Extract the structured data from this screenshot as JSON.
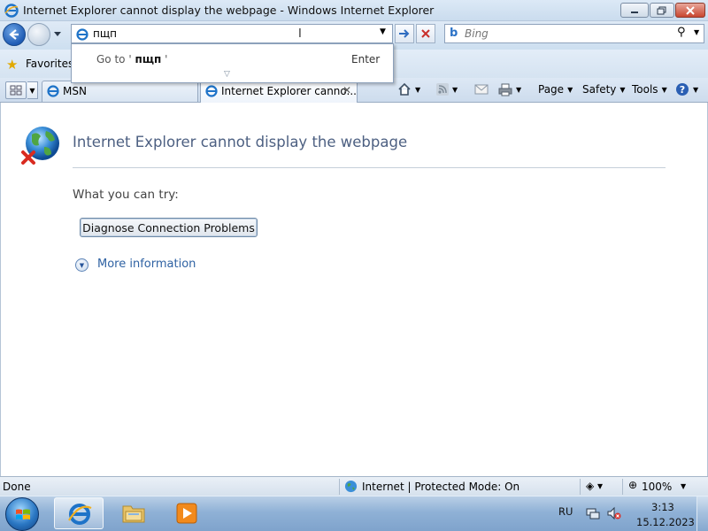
{
  "window": {
    "title": "Internet Explorer cannot display the webpage - Windows Internet Explorer",
    "icon": "ie-icon"
  },
  "navigation": {
    "address_value": "пщп",
    "search_placeholder": "Bing",
    "autocomplete": {
      "prefix": "Go to ' ",
      "query": "пщп",
      "suffix": " '",
      "action_label": "Enter"
    }
  },
  "favorites": {
    "label": "Favorites"
  },
  "tabs": [
    {
      "label": "MSN",
      "active": false
    },
    {
      "label": "Internet Explorer canno...",
      "active": true
    }
  ],
  "command_bar": {
    "page_label": "Page",
    "safety_label": "Safety",
    "tools_label": "Tools"
  },
  "content": {
    "heading": "Internet Explorer cannot display the webpage",
    "what_you_can_try": "What you can try:",
    "diagnose_button": "Diagnose Connection Problems",
    "more_information": "More information"
  },
  "status_bar": {
    "status": "Done",
    "zone": "Internet | Protected Mode: On",
    "zoom": "100%"
  },
  "taskbar": {
    "language": "RU",
    "time": "3:13",
    "date": "15.12.2023"
  },
  "colors": {
    "heading": "#4d6082",
    "link": "#2f62a3",
    "accent": "#1f5cb5"
  }
}
